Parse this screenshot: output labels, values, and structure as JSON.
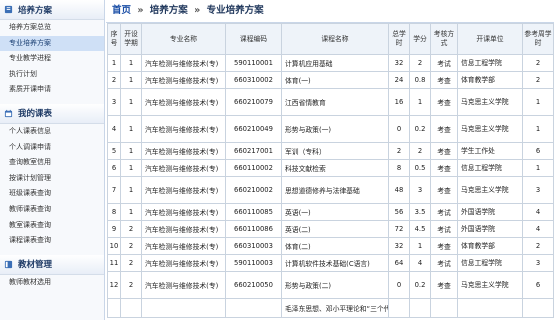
{
  "sidebar": {
    "sections": [
      {
        "title": "培养方案",
        "items": [
          {
            "label": "培养方案总览",
            "active": false
          },
          {
            "label": "专业培养方案",
            "active": true
          },
          {
            "label": "专业教学进程",
            "active": false
          },
          {
            "label": "执行计划",
            "active": false
          },
          {
            "label": "素质开课申请",
            "active": false
          }
        ]
      },
      {
        "title": "我的课表",
        "items": [
          {
            "label": "个人课表信息",
            "active": false
          },
          {
            "label": "个人调课申请",
            "active": false
          },
          {
            "label": "查询教室信用",
            "active": false
          },
          {
            "label": "按课计划管理",
            "active": false
          },
          {
            "label": "班级课表查询",
            "active": false
          },
          {
            "label": "教师课表查询",
            "active": false
          },
          {
            "label": "教室课表查询",
            "active": false
          },
          {
            "label": "课程课表查询",
            "active": false
          }
        ]
      },
      {
        "title": "教材管理",
        "items": [
          {
            "label": "教师教材选用",
            "active": false
          }
        ]
      }
    ]
  },
  "breadcrumb": {
    "home": "首页",
    "separator": "»",
    "level1": "培养方案",
    "level2": "专业培养方案"
  },
  "table": {
    "headers": [
      "序号",
      "开设学期",
      "专业名称",
      "课程编码",
      "课程名称",
      "总学时",
      "学分",
      "考核方式",
      "开课单位",
      "参考周学时"
    ],
    "rows": [
      [
        "1",
        "1",
        "汽车检测与维修技术(专)",
        "590110001",
        "计算机应用基础",
        "32",
        "2",
        "考试",
        "信息工程学院",
        "2"
      ],
      [
        "2",
        "1",
        "汽车检测与维修技术(专)",
        "660310002",
        "体育(一)",
        "24",
        "0.8",
        "考查",
        "体育教学部",
        "2"
      ],
      [
        "3",
        "1",
        "汽车检测与维修技术(专)",
        "660210079",
        "江西省情教育",
        "16",
        "1",
        "考查",
        "马克思主义学院",
        "1"
      ],
      [
        "4",
        "1",
        "汽车检测与维修技术(专)",
        "660210049",
        "形势与政策(一)",
        "0",
        "0.2",
        "考查",
        "马克思主义学院",
        "1"
      ],
      [
        "5",
        "1",
        "汽车检测与维修技术(专)",
        "660217001",
        "军训（专科）",
        "2",
        "2",
        "考查",
        "学生工作处",
        "6"
      ],
      [
        "6",
        "1",
        "汽车检测与维修技术(专)",
        "660110002",
        "科技文献检索",
        "8",
        "0.5",
        "考查",
        "信息工程学院",
        "1"
      ],
      [
        "7",
        "1",
        "汽车检测与维修技术(专)",
        "660210002",
        "思想道德修养与法律基础",
        "48",
        "3",
        "考查",
        "马克思主义学院",
        "3"
      ],
      [
        "8",
        "1",
        "汽车检测与维修技术(专)",
        "660110085",
        "英语(一)",
        "56",
        "3.5",
        "考试",
        "外国语学院",
        "4"
      ],
      [
        "9",
        "2",
        "汽车检测与维修技术(专)",
        "660110086",
        "英语(二)",
        "72",
        "4.5",
        "考试",
        "外国语学院",
        "4"
      ],
      [
        "10",
        "2",
        "汽车检测与维修技术(专)",
        "660310003",
        "体育(二)",
        "32",
        "1",
        "考查",
        "体育教学部",
        "2"
      ],
      [
        "11",
        "2",
        "汽车检测与维修技术(专)",
        "590110003",
        "计算机软件技术基础(C语言)",
        "64",
        "4",
        "考试",
        "信息工程学院",
        "3"
      ],
      [
        "12",
        "2",
        "汽车检测与维修技术(专)",
        "660210050",
        "形势与政策(二)",
        "0",
        "0.2",
        "考查",
        "马克思主义学院",
        "6"
      ]
    ],
    "partial_row": [
      "",
      "",
      "",
      "",
      "毛泽东思想、邓小平理论和“三个代",
      "",
      "",
      "",
      "",
      ""
    ]
  },
  "colors": {
    "sidebar_bg": "#f7f9fc",
    "active_item": "#cfe0f6",
    "header_bg": "#eef3f9",
    "link": "#1a4ea6"
  }
}
